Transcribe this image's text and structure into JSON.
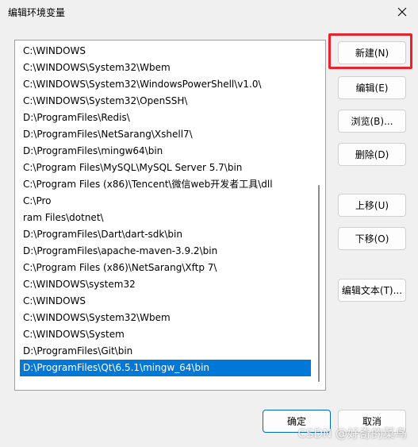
{
  "window": {
    "title": "编辑环境变量"
  },
  "path_list": {
    "items": [
      "C:\\WINDOWS",
      "C:\\WINDOWS\\System32\\Wbem",
      "C:\\WINDOWS\\System32\\WindowsPowerShell\\v1.0\\",
      "C:\\WINDOWS\\System32\\OpenSSH\\",
      "D:\\ProgramFiles\\Redis\\",
      "D:\\ProgramFiles\\NetSarang\\Xshell7\\",
      "D:\\ProgramFiles\\mingw64\\bin",
      "C:\\Program Files\\MySQL\\MySQL Server 5.7\\bin",
      "C:\\Program Files (x86)\\Tencent\\微信web开发者工具\\dll",
      "C:\\Pro",
      "ram Files\\dotnet\\",
      "D:\\ProgramFiles\\Dart\\dart-sdk\\bin",
      "D:\\ProgramFiles\\apache-maven-3.9.2\\bin",
      "C:\\Program Files (x86)\\NetSarang\\Xftp 7\\",
      "C:\\WINDOWS\\system32",
      "C:\\WINDOWS",
      "C:\\WINDOWS\\System32\\Wbem",
      "C:\\WINDOWS\\System",
      "D:\\ProgramFiles\\Git\\bin",
      "D:\\ProgramFiles\\Qt\\6.5.1\\mingw_64\\bin"
    ],
    "selected_index": 19
  },
  "buttons": {
    "new": "新建(N)",
    "edit": "编辑(E)",
    "browse": "浏览(B)...",
    "delete": "删除(D)",
    "move_up": "上移(U)",
    "move_down": "下移(O)",
    "edit_text": "编辑文本(T)...",
    "ok": "确定",
    "cancel": "取消"
  },
  "watermark": "CSDN @好奇的菜鸟",
  "colors": {
    "selection": "#0078d7",
    "highlight_box": "#e8232d",
    "default_button_border": "#0067c0"
  }
}
